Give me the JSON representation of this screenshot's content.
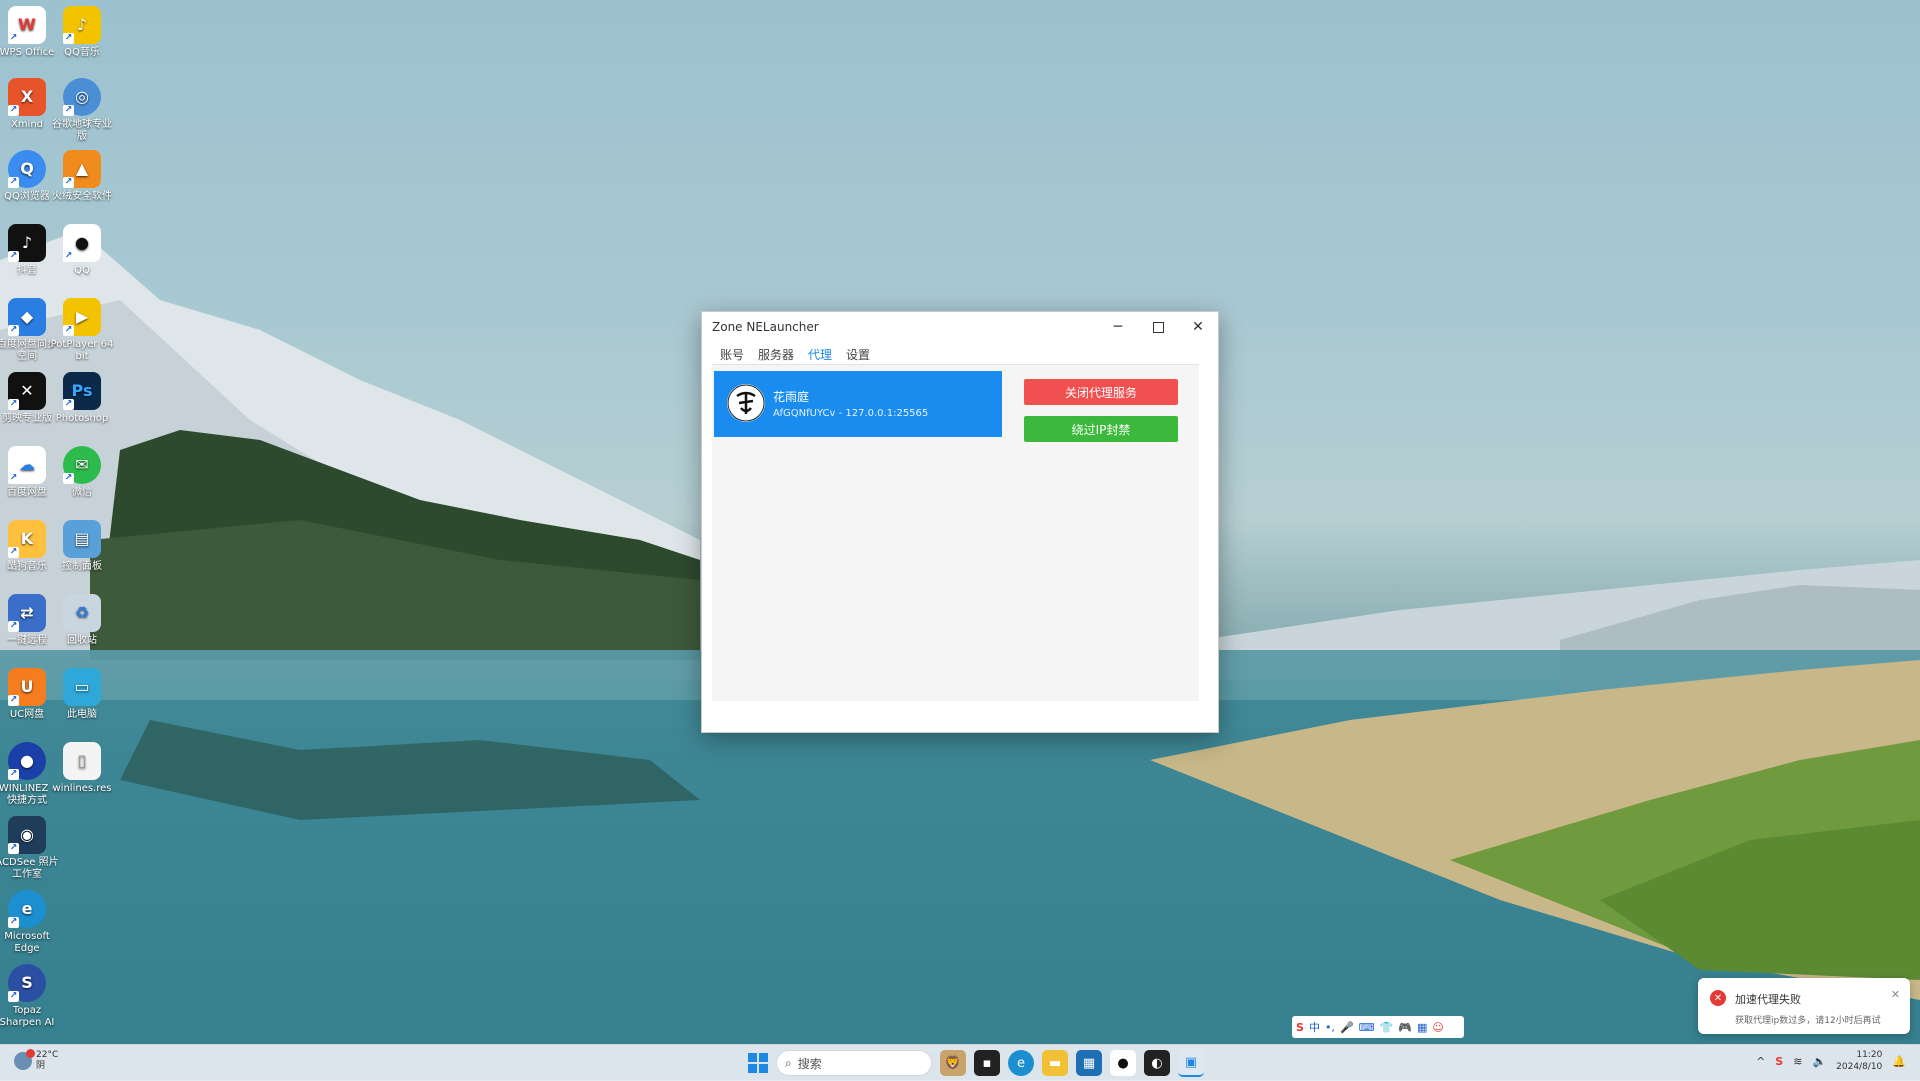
{
  "desktop": {
    "icons": [
      {
        "label": "WPS Office",
        "icon": "wps-icon",
        "color": "#e53935",
        "glyph": "W"
      },
      {
        "label": "QQ音乐",
        "icon": "qq-music-icon",
        "color": "#f3c300",
        "glyph": "♪"
      },
      {
        "label": "Xmind",
        "icon": "xmind-icon",
        "color": "#e8542a",
        "glyph": "X"
      },
      {
        "label": "谷歌地球专业版",
        "icon": "google-earth-icon",
        "color": "#4a8fd6",
        "glyph": "◎"
      },
      {
        "label": "QQ浏览器",
        "icon": "qq-browser-icon",
        "color": "#3b8cf0",
        "glyph": "Q"
      },
      {
        "label": "火绒安全软件",
        "icon": "huorong-icon",
        "color": "#f08c1e",
        "glyph": "▲"
      },
      {
        "label": "抖音",
        "icon": "douyin-icon",
        "color": "#111111",
        "glyph": "♪"
      },
      {
        "label": "QQ",
        "icon": "qq-icon",
        "color": "#ffffff",
        "glyph": "●"
      },
      {
        "label": "百度网盘同步空间",
        "icon": "baidu-sync-icon",
        "color": "#2a7de1",
        "glyph": "◆"
      },
      {
        "label": "PotPlayer 64 bit",
        "icon": "potplayer-icon",
        "color": "#f3c300",
        "glyph": "▶"
      },
      {
        "label": "剪映专业版",
        "icon": "jianying-icon",
        "color": "#111111",
        "glyph": "✕"
      },
      {
        "label": "Photoshop",
        "icon": "photoshop-icon",
        "color": "#0b2a4a",
        "glyph": "Ps"
      },
      {
        "label": "百度网盘",
        "icon": "baidu-netdisk-icon",
        "color": "#ffffff",
        "glyph": "☁"
      },
      {
        "label": "微信",
        "icon": "wechat-icon",
        "color": "#2dbb4d",
        "glyph": "✉"
      },
      {
        "label": "酷狗音乐",
        "icon": "kugou-icon",
        "color": "#ffc13d",
        "glyph": "K"
      },
      {
        "label": "控制面板",
        "icon": "control-panel-icon",
        "color": "#5aa0d8",
        "glyph": "▤"
      },
      {
        "label": "一键远程",
        "icon": "remote-icon",
        "color": "#3a6ec8",
        "glyph": "⇄"
      },
      {
        "label": "回收站",
        "icon": "recycle-bin-icon",
        "color": "#c9d6e0",
        "glyph": "♻"
      },
      {
        "label": "UC网盘",
        "icon": "uc-netdisk-icon",
        "color": "#f57c1f",
        "glyph": "U"
      },
      {
        "label": "此电脑",
        "icon": "this-pc-icon",
        "color": "#2fa7d8",
        "glyph": "▭"
      },
      {
        "label": "WINLINEZ - 快捷方式",
        "icon": "winlinez-icon",
        "color": "#1a3fa8",
        "glyph": "●"
      },
      {
        "label": "winlines.res",
        "icon": "file-icon",
        "color": "#f4f4f4",
        "glyph": "▯"
      },
      {
        "label": "ACDSee 照片工作室",
        "icon": "acdsee-icon",
        "color": "#1f3c5a",
        "glyph": "◉"
      },
      {
        "label": "Microsoft Edge",
        "icon": "edge-icon",
        "color": "#1c8fd1",
        "glyph": "e"
      },
      {
        "label": "Topaz Sharpen AI",
        "icon": "topaz-icon",
        "color": "#2b4fa3",
        "glyph": "S"
      }
    ]
  },
  "window": {
    "title": "Zone NELauncher",
    "tabs": [
      {
        "label": "账号",
        "active": false
      },
      {
        "label": "服务器",
        "active": false
      },
      {
        "label": "代理",
        "active": true
      },
      {
        "label": "设置",
        "active": false
      }
    ],
    "proxy": {
      "avatar_text": "花雨庭",
      "name": "花雨庭",
      "address": "AfGQNfUYCv - 127.0.0.1:25565"
    },
    "buttons": {
      "close_proxy": "关闭代理服务",
      "bypass_ip": "绕过IP封禁"
    },
    "colors": {
      "accent": "#1a8cf0",
      "danger": "#f05050",
      "success": "#3cb93c"
    }
  },
  "notification": {
    "title": "加速代理失败",
    "body": "获取代理ip数过多，请12小时后再试"
  },
  "ime": {
    "items": [
      "S",
      "中",
      "•,",
      "🎤",
      "⌨",
      "👕",
      "🎮",
      "▦",
      "☺"
    ]
  },
  "taskbar": {
    "weather": {
      "temp": "22°C",
      "condition": "阴"
    },
    "search_placeholder": "搜索",
    "tray": {
      "caret": "^",
      "time": "11:20",
      "date": "2024/8/10"
    }
  }
}
